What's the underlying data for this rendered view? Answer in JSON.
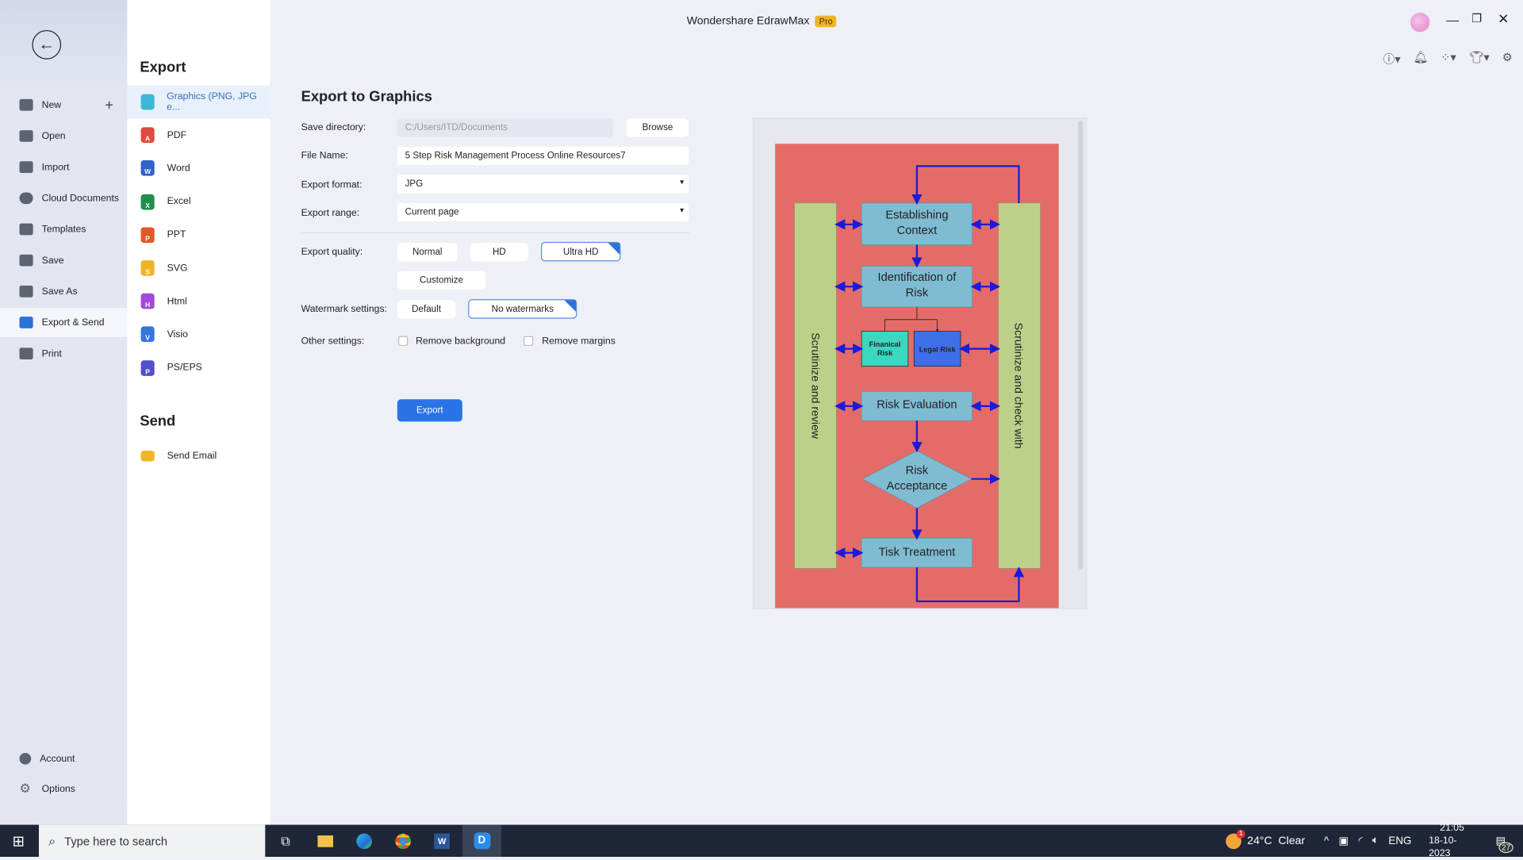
{
  "app": {
    "title": "Wondershare EdrawMax",
    "badge": "Pro"
  },
  "sidebar": {
    "items": [
      {
        "label": "New"
      },
      {
        "label": "Open"
      },
      {
        "label": "Import"
      },
      {
        "label": "Cloud Documents"
      },
      {
        "label": "Templates"
      },
      {
        "label": "Save"
      },
      {
        "label": "Save As"
      },
      {
        "label": "Export & Send"
      },
      {
        "label": "Print"
      }
    ],
    "bottom": [
      {
        "label": "Account"
      },
      {
        "label": "Options"
      }
    ]
  },
  "export_col": {
    "export_heading": "Export",
    "items": [
      {
        "label": "Graphics (PNG, JPG e...",
        "color": "#3bb8d8",
        "letter": ""
      },
      {
        "label": "PDF",
        "color": "#e04b3f",
        "letter": "A"
      },
      {
        "label": "Word",
        "color": "#2f63c9",
        "letter": "W"
      },
      {
        "label": "Excel",
        "color": "#1f8f4e",
        "letter": "X"
      },
      {
        "label": "PPT",
        "color": "#e0582b",
        "letter": "P"
      },
      {
        "label": "SVG",
        "color": "#f0b429",
        "letter": "S"
      },
      {
        "label": "Html",
        "color": "#a349d6",
        "letter": "H"
      },
      {
        "label": "Visio",
        "color": "#3577d9",
        "letter": "V"
      },
      {
        "label": "PS/EPS",
        "color": "#5151c9",
        "letter": "P"
      }
    ],
    "send_heading": "Send",
    "send_items": [
      {
        "label": "Send Email"
      }
    ]
  },
  "form": {
    "title": "Export to Graphics",
    "save_directory": {
      "label": "Save directory:",
      "value": "C:/Users/ITD/Documents",
      "browse": "Browse"
    },
    "file_name": {
      "label": "File Name:",
      "value": "5 Step Risk Management Process Online Resources7"
    },
    "export_format": {
      "label": "Export format:",
      "value": "JPG"
    },
    "export_range": {
      "label": "Export range:",
      "value": "Current page"
    },
    "export_quality": {
      "label": "Export quality:",
      "options": [
        "Normal",
        "HD",
        "Ultra HD",
        "Customize"
      ],
      "selected": "Ultra HD"
    },
    "watermark": {
      "label": "Watermark settings:",
      "options": [
        "Default",
        "No watermarks"
      ],
      "selected": "No watermarks"
    },
    "other": {
      "label": "Other settings:",
      "remove_background": "Remove background",
      "remove_margins": "Remove margins",
      "remove_background_checked": false,
      "remove_margins_checked": false
    },
    "export_button": "Export"
  },
  "diagram": {
    "left_bar": "Scrutinize and review",
    "right_bar": "Scrutinize and check with",
    "boxes": {
      "establishing": [
        "Establishing",
        "Context"
      ],
      "identification": [
        "Identification of",
        "Risk"
      ],
      "financial": [
        "Finanical",
        "Risk"
      ],
      "legal": "Legal Risk",
      "evaluation": "Risk Evaluation",
      "acceptance": [
        "Risk",
        "Acceptance"
      ],
      "treatment": "Tisk Treatment"
    },
    "colors": {
      "background": "#e46c68",
      "bar": "#bcd08a",
      "box": "#7fbcd2",
      "financial": "#3dd6c0",
      "legal": "#3f6fe8",
      "arrow": "#1a1ad8"
    }
  },
  "taskbar": {
    "search_placeholder": "Type here to search",
    "weather": "24°C  Clear",
    "weather_badge": "1",
    "lang": "ENG",
    "time": "21:05",
    "date": "18-10-2023",
    "notifications": "27"
  }
}
